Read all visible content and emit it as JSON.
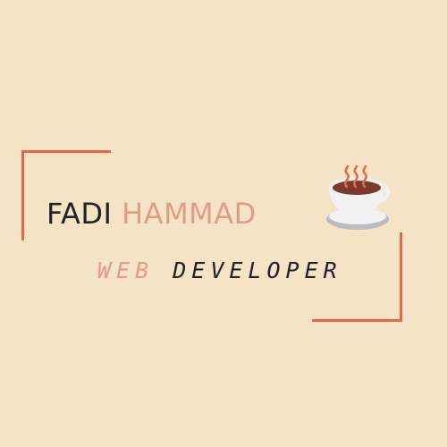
{
  "logo": {
    "first_name": "FADI",
    "last_name": "HAMMAD",
    "tagline_first": "WEB",
    "tagline_second": "DEVELOPER",
    "cup_icon": "coffee-cup-icon"
  },
  "colors": {
    "background": "#f5e3c6",
    "frame": "#e2674b",
    "dark_text": "#222222",
    "accent_text": "#dd9f84",
    "cup_body": "#f1f1f1",
    "cup_shadow": "#b9bcc3",
    "coffee": "#7a3b2c",
    "steam": "#e2674b"
  }
}
